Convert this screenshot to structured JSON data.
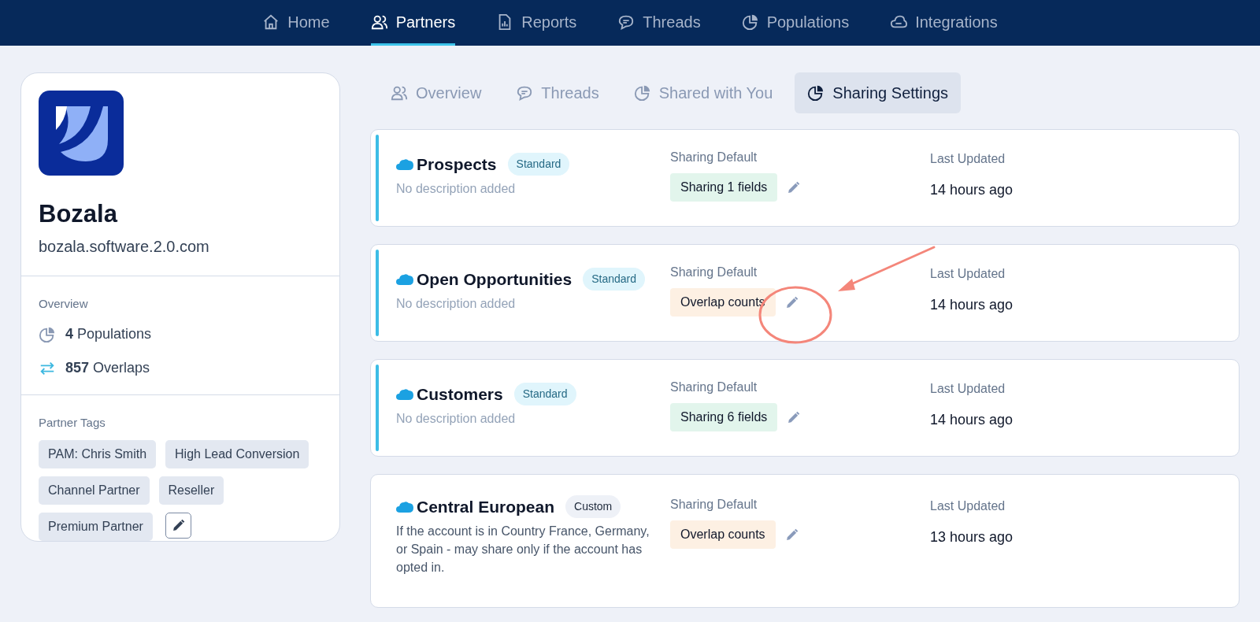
{
  "nav": [
    {
      "label": "Home",
      "selected": false
    },
    {
      "label": "Partners",
      "selected": true
    },
    {
      "label": "Reports",
      "selected": false
    },
    {
      "label": "Threads",
      "selected": false
    },
    {
      "label": "Populations",
      "selected": false
    },
    {
      "label": "Integrations",
      "selected": false
    }
  ],
  "partner": {
    "name": "Bozala",
    "domain": "bozala.software.2.0.com",
    "overview_title": "Overview",
    "stats": [
      {
        "value": "4",
        "label": "Populations"
      },
      {
        "value": "857",
        "label": "Overlaps"
      }
    ],
    "tags_title": "Partner Tags",
    "tags": [
      "PAM: Chris Smith",
      "High Lead Conversion",
      "Channel Partner",
      "Reseller",
      "Premium Partner"
    ]
  },
  "tabs": [
    {
      "label": "Overview",
      "selected": false
    },
    {
      "label": "Threads",
      "selected": false
    },
    {
      "label": "Shared with You",
      "selected": false
    },
    {
      "label": "Sharing Settings",
      "selected": true
    }
  ],
  "populations": [
    {
      "name": "Prospects",
      "badge": {
        "label": "Standard",
        "kind": "standard"
      },
      "accent": true,
      "description": {
        "text": "No description added",
        "kind": "placeholder"
      },
      "sharing_label": "Sharing Default",
      "sharing": {
        "label": "Sharing 1 fields",
        "kind": "fields"
      },
      "updated_label": "Last Updated",
      "updated": "14 hours ago"
    },
    {
      "name": "Open Opportunities",
      "badge": {
        "label": "Standard",
        "kind": "standard"
      },
      "accent": true,
      "description": {
        "text": "No description added",
        "kind": "placeholder"
      },
      "sharing_label": "Sharing Default",
      "sharing": {
        "label": "Overlap counts",
        "kind": "counts"
      },
      "updated_label": "Last Updated",
      "updated": "14 hours ago"
    },
    {
      "name": "Customers",
      "badge": {
        "label": "Standard",
        "kind": "standard"
      },
      "accent": true,
      "description": {
        "text": "No description added",
        "kind": "placeholder"
      },
      "sharing_label": "Sharing Default",
      "sharing": {
        "label": "Sharing 6 fields",
        "kind": "fields"
      },
      "updated_label": "Last Updated",
      "updated": "14 hours ago"
    },
    {
      "name": "Central European",
      "badge": {
        "label": "Custom",
        "kind": "custom"
      },
      "accent": false,
      "description": {
        "text": "If the account is in Country France, Germany, or Spain - may share only if the account has opted in.",
        "kind": "text"
      },
      "sharing_label": "Sharing Default",
      "sharing": {
        "label": "Overlap counts",
        "kind": "counts"
      },
      "updated_label": "Last Updated",
      "updated": "13 hours ago"
    }
  ]
}
